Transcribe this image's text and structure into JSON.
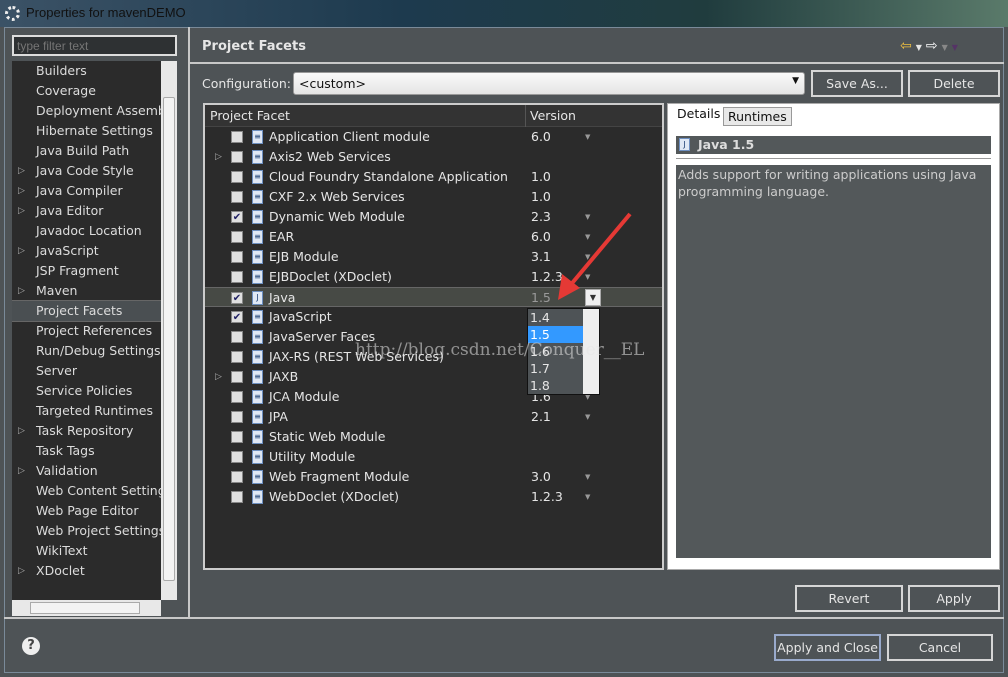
{
  "window": {
    "title": "Properties for mavenDEMO"
  },
  "sidebar": {
    "filter_placeholder": "type filter text",
    "items": [
      {
        "label": "Builders",
        "expandable": false
      },
      {
        "label": "Coverage",
        "expandable": false
      },
      {
        "label": "Deployment Assembly",
        "expandable": false
      },
      {
        "label": "Hibernate Settings",
        "expandable": false
      },
      {
        "label": "Java Build Path",
        "expandable": false
      },
      {
        "label": "Java Code Style",
        "expandable": true
      },
      {
        "label": "Java Compiler",
        "expandable": true
      },
      {
        "label": "Java Editor",
        "expandable": true
      },
      {
        "label": "Javadoc Location",
        "expandable": false
      },
      {
        "label": "JavaScript",
        "expandable": true
      },
      {
        "label": "JSP Fragment",
        "expandable": false
      },
      {
        "label": "Maven",
        "expandable": true
      },
      {
        "label": "Project Facets",
        "expandable": false,
        "selected": true
      },
      {
        "label": "Project References",
        "expandable": false
      },
      {
        "label": "Run/Debug Settings",
        "expandable": false
      },
      {
        "label": "Server",
        "expandable": false
      },
      {
        "label": "Service Policies",
        "expandable": false
      },
      {
        "label": "Targeted Runtimes",
        "expandable": false
      },
      {
        "label": "Task Repository",
        "expandable": true
      },
      {
        "label": "Task Tags",
        "expandable": false
      },
      {
        "label": "Validation",
        "expandable": true
      },
      {
        "label": "Web Content Settings",
        "expandable": false
      },
      {
        "label": "Web Page Editor",
        "expandable": false
      },
      {
        "label": "Web Project Settings",
        "expandable": false
      },
      {
        "label": "WikiText",
        "expandable": false
      },
      {
        "label": "XDoclet",
        "expandable": true
      }
    ]
  },
  "page": {
    "title": "Project Facets",
    "config_label": "Configuration:",
    "config_value": "<custom>",
    "save_as": "Save As...",
    "delete": "Delete"
  },
  "facets": {
    "col_facet": "Project Facet",
    "col_version": "Version",
    "rows": [
      {
        "name": "Application Client module",
        "version": "6.0",
        "checked": false,
        "dd": true
      },
      {
        "name": "Axis2 Web Services",
        "version": "",
        "checked": false,
        "expand": true
      },
      {
        "name": "Cloud Foundry Standalone Application",
        "version": "1.0",
        "checked": false
      },
      {
        "name": "CXF 2.x Web Services",
        "version": "1.0",
        "checked": false
      },
      {
        "name": "Dynamic Web Module",
        "version": "2.3",
        "checked": true,
        "dd": true
      },
      {
        "name": "EAR",
        "version": "6.0",
        "checked": false,
        "dd": true
      },
      {
        "name": "EJB Module",
        "version": "3.1",
        "checked": false,
        "dd": true
      },
      {
        "name": "EJBDoclet (XDoclet)",
        "version": "1.2.3",
        "checked": false,
        "dd": true
      },
      {
        "name": "Java",
        "version": "1.5",
        "checked": true,
        "selected": true
      },
      {
        "name": "JavaScript",
        "version": "",
        "checked": true
      },
      {
        "name": "JavaServer Faces",
        "version": "",
        "checked": false
      },
      {
        "name": "JAX-RS (REST Web Services)",
        "version": "",
        "checked": false
      },
      {
        "name": "JAXB",
        "version": "",
        "checked": false,
        "expand": true
      },
      {
        "name": "JCA Module",
        "version": "1.6",
        "checked": false,
        "dd": true
      },
      {
        "name": "JPA",
        "version": "2.1",
        "checked": false,
        "dd": true
      },
      {
        "name": "Static Web Module",
        "version": "",
        "checked": false
      },
      {
        "name": "Utility Module",
        "version": "",
        "checked": false
      },
      {
        "name": "Web Fragment Module",
        "version": "3.0",
        "checked": false,
        "dd": true
      },
      {
        "name": "WebDoclet (XDoclet)",
        "version": "1.2.3",
        "checked": false,
        "dd": true
      }
    ],
    "version_options": [
      "1.4",
      "1.5",
      "1.6",
      "1.7",
      "1.8"
    ],
    "selected_option": "1.5"
  },
  "details": {
    "tab_details": "Details",
    "tab_runtimes": "Runtimes",
    "title": "Java 1.5",
    "description": "Adds support for writing applications using Java programming language."
  },
  "buttons": {
    "revert": "Revert",
    "apply": "Apply",
    "apply_close": "Apply and Close",
    "cancel": "Cancel",
    "help": "?"
  },
  "watermark": "http://blog.csdn.net/Conquer__EL",
  "colors": {
    "accent": "#3399ff",
    "arrow": "#e53935"
  }
}
